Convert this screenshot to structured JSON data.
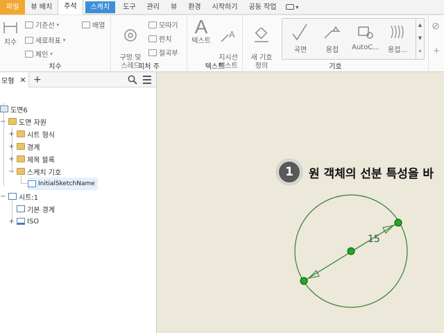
{
  "menubar": {
    "items": [
      "파일",
      "뷰 배치",
      "주석",
      "스케치",
      "도구",
      "관리",
      "뷰",
      "환경",
      "시작하기",
      "공동 작업"
    ],
    "file_color": "#f0a830",
    "context_color": "#3d8ed8"
  },
  "ribbon": {
    "dimension": {
      "title": "치수",
      "big_label": "치수",
      "baseline": "기준선",
      "ordinate": "세로좌표",
      "chain": "체인",
      "arrange": "배열"
    },
    "feature": {
      "title": "피처 주",
      "hole_thread": "구멍 및\n스레드",
      "chamfer": "모따기",
      "punch": "펀치",
      "bend": "절곡부"
    },
    "text": {
      "title": "텍스트",
      "text": "텍스트",
      "leader_text": "지시선\n텍스트",
      "a_glyph": "A"
    },
    "symbols": {
      "title": "기호",
      "new_symbol": "새 기호\n정의",
      "surface": "곡면",
      "weld": "용접",
      "autocad": "AutoC...",
      "weld2": "용접..."
    }
  },
  "browser": {
    "tab_label": "모형",
    "tree": {
      "root": "도면6",
      "resources": "도면 자원",
      "sheet_formats": "시트 형식",
      "borders": "경계",
      "title_blocks": "제목 블록",
      "sketch_symbols": "스케치 기호",
      "initial_sketch": "InitialSketchName",
      "sheet": "시트:1",
      "default_border": "기본 경계",
      "iso": "ISO"
    }
  },
  "canvas": {
    "step_number": "1",
    "instruction": "원 객체의 선분 특성을 바",
    "dimension_value": "15",
    "circle_color": "#2e7d32",
    "point_color": "#22aa22"
  }
}
